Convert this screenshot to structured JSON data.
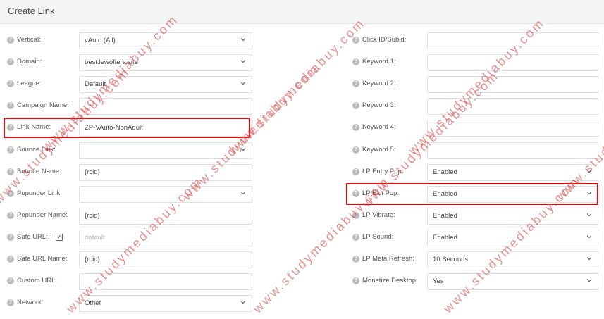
{
  "header": {
    "title": "Create Link"
  },
  "help_glyph": "?",
  "checkmark": "✓",
  "left_fields": [
    {
      "label": "Vertical:",
      "value": "vAuto (All)",
      "kind": "select"
    },
    {
      "label": "Domain:",
      "value": "best.lewoffers.site",
      "kind": "select"
    },
    {
      "label": "League:",
      "value": "Default",
      "kind": "select"
    },
    {
      "label": "Campaign Name:",
      "value": "",
      "kind": "input"
    },
    {
      "label": "Link Name:",
      "value": "ZP-VAuto-NonAdult",
      "kind": "input"
    },
    {
      "label": "Bounce Link:",
      "value": "",
      "kind": "select"
    },
    {
      "label": "Bounce Name:",
      "value": "{rcid}",
      "kind": "input"
    },
    {
      "label": "Popunder Link:",
      "value": "",
      "kind": "select"
    },
    {
      "label": "Popunder Name:",
      "value": "{rcid}",
      "kind": "input"
    },
    {
      "label": "Safe URL:",
      "value": "",
      "placeholder": "default",
      "kind": "input",
      "checked": true
    },
    {
      "label": "Safe URL Name:",
      "value": "{rcid}",
      "kind": "input"
    },
    {
      "label": "Custom URL:",
      "value": "",
      "kind": "input"
    },
    {
      "label": "Network:",
      "value": "Other",
      "kind": "select"
    }
  ],
  "right_fields": [
    {
      "label": "Click ID/Subid:",
      "value": "",
      "kind": "input"
    },
    {
      "label": "Keyword 1:",
      "value": "",
      "kind": "input"
    },
    {
      "label": "Keyword 2:",
      "value": "",
      "kind": "input"
    },
    {
      "label": "Keyword 3:",
      "value": "",
      "kind": "input"
    },
    {
      "label": "Keyword 4:",
      "value": "",
      "kind": "input"
    },
    {
      "label": "Keyword 5:",
      "value": "",
      "kind": "input"
    },
    {
      "label": "LP Entry Pop:",
      "value": "Enabled",
      "kind": "select"
    },
    {
      "label": "LP Exit Pop:",
      "value": "Enabled",
      "kind": "select"
    },
    {
      "label": "LP Vibrate:",
      "value": "Enabled",
      "kind": "select"
    },
    {
      "label": "LP Sound:",
      "value": "Enabled",
      "kind": "select"
    },
    {
      "label": "LP Meta Refresh:",
      "value": "10 Seconds",
      "kind": "select"
    },
    {
      "label": "Monetize Desktop:",
      "value": "Yes",
      "kind": "select"
    }
  ],
  "watermark": {
    "text": "www.studymediabuy.com",
    "color": "#d74646"
  },
  "highlight_color": "#cc1111"
}
